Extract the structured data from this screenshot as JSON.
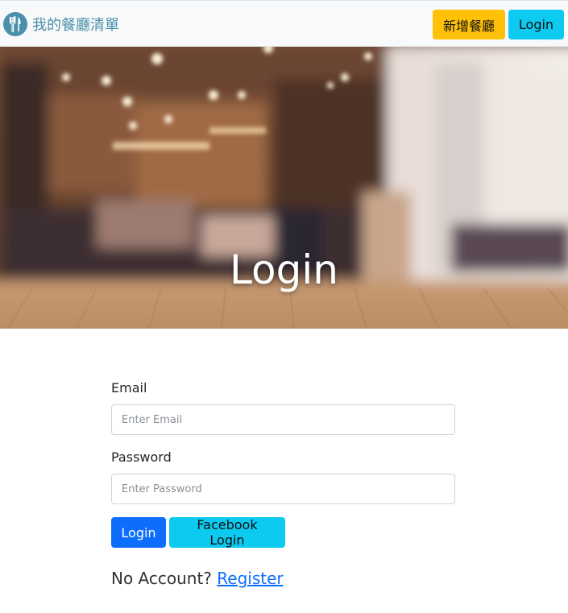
{
  "navbar": {
    "brand_text": "我的餐廳清單",
    "brand_icon": "fork-knife-icon",
    "add_restaurant_label": "新增餐廳",
    "login_label": "Login"
  },
  "hero": {
    "title": "Login"
  },
  "form": {
    "email_label": "Email",
    "email_placeholder": "Enter Email",
    "email_value": "",
    "password_label": "Password",
    "password_placeholder": "Enter Password",
    "password_value": "",
    "login_button": "Login",
    "facebook_button": "Facebook Login",
    "no_account_text": "No Account?",
    "register_link": "Register"
  },
  "colors": {
    "brand": "#4a90aa",
    "warning": "#ffc107",
    "info": "#0dcaf0",
    "primary": "#0d6efd",
    "navbar_bg": "#f8f9fa"
  }
}
